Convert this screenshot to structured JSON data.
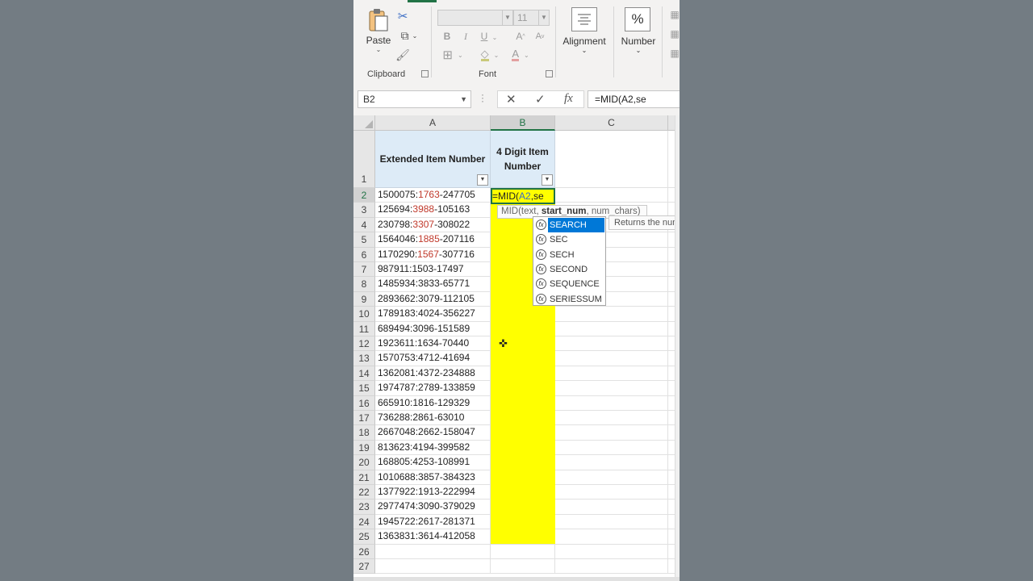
{
  "ribbon": {
    "clipboard": {
      "paste_label": "Paste",
      "group_label": "Clipboard"
    },
    "font": {
      "font_name": "",
      "font_size": "11",
      "bold": "B",
      "italic": "I",
      "underline": "U",
      "grow": "A",
      "shrink": "A",
      "font_color_letter": "A",
      "group_label": "Font"
    },
    "alignment_label": "Alignment",
    "number_label": "Number",
    "number_icon": "%"
  },
  "formula_bar": {
    "name_box": "B2",
    "cancel_icon": "✕",
    "enter_icon": "✓",
    "fx_icon": "fx",
    "formula": "=MID(A2,se"
  },
  "columns": [
    {
      "label": "A"
    },
    {
      "label": "B"
    },
    {
      "label": "C"
    }
  ],
  "header_row": {
    "a1": "Extended Item Number",
    "b1": "4 Digit Item Number"
  },
  "rows": [
    {
      "num": "1"
    },
    {
      "num": "2",
      "pre": "1500075:",
      "mid": "1763",
      "post": "-247705"
    },
    {
      "num": "3",
      "pre": "125694:",
      "mid": "3988",
      "post": "-105163"
    },
    {
      "num": "4",
      "pre": "230798:",
      "mid": "3307",
      "post": "-308022"
    },
    {
      "num": "5",
      "pre": "1564046:",
      "mid": "1885",
      "post": "-207116"
    },
    {
      "num": "6",
      "pre": "1170290:",
      "mid": "1567",
      "post": "-307716"
    },
    {
      "num": "7",
      "pre": "987911:1503-17497",
      "mid": "",
      "post": ""
    },
    {
      "num": "8",
      "pre": "1485934:3833-65771",
      "mid": "",
      "post": ""
    },
    {
      "num": "9",
      "pre": "2893662:3079-112105",
      "mid": "",
      "post": ""
    },
    {
      "num": "10",
      "pre": "1789183:4024-356227",
      "mid": "",
      "post": ""
    },
    {
      "num": "11",
      "pre": "689494:3096-151589",
      "mid": "",
      "post": ""
    },
    {
      "num": "12",
      "pre": "1923611:1634-70440",
      "mid": "",
      "post": ""
    },
    {
      "num": "13",
      "pre": "1570753:4712-41694",
      "mid": "",
      "post": ""
    },
    {
      "num": "14",
      "pre": "1362081:4372-234888",
      "mid": "",
      "post": ""
    },
    {
      "num": "15",
      "pre": "1974787:2789-133859",
      "mid": "",
      "post": ""
    },
    {
      "num": "16",
      "pre": "665910:1816-129329",
      "mid": "",
      "post": ""
    },
    {
      "num": "17",
      "pre": "736288:2861-63010",
      "mid": "",
      "post": ""
    },
    {
      "num": "18",
      "pre": "2667048:2662-158047",
      "mid": "",
      "post": ""
    },
    {
      "num": "19",
      "pre": "813623:4194-399582",
      "mid": "",
      "post": ""
    },
    {
      "num": "20",
      "pre": "168805:4253-108991",
      "mid": "",
      "post": ""
    },
    {
      "num": "21",
      "pre": "1010688:3857-384323",
      "mid": "",
      "post": ""
    },
    {
      "num": "22",
      "pre": "1377922:1913-222994",
      "mid": "",
      "post": ""
    },
    {
      "num": "23",
      "pre": "2977474:3090-379029",
      "mid": "",
      "post": ""
    },
    {
      "num": "24",
      "pre": "1945722:2617-281371",
      "mid": "",
      "post": ""
    },
    {
      "num": "25",
      "pre": "1363831:3614-412058",
      "mid": "",
      "post": ""
    },
    {
      "num": "26"
    },
    {
      "num": "27"
    }
  ],
  "editing": {
    "prefix": "=MID(",
    "ref": "A2",
    "suffix": ",se",
    "tooltip_pre": "MID(text, ",
    "tooltip_bold": "start_num",
    "tooltip_post": ", num_chars)"
  },
  "autocomplete": {
    "items": [
      "SEARCH",
      "SEC",
      "SECH",
      "SECOND",
      "SEQUENCE",
      "SERIESSUM"
    ],
    "selected": "SEARCH",
    "description": "Returns the num"
  },
  "colors": {
    "accent": "#217346",
    "highlight_fill": "#ffff00",
    "header_fill": "#ddebf7",
    "digits_red": "#c0392b",
    "selection_blue": "#0078d7"
  }
}
